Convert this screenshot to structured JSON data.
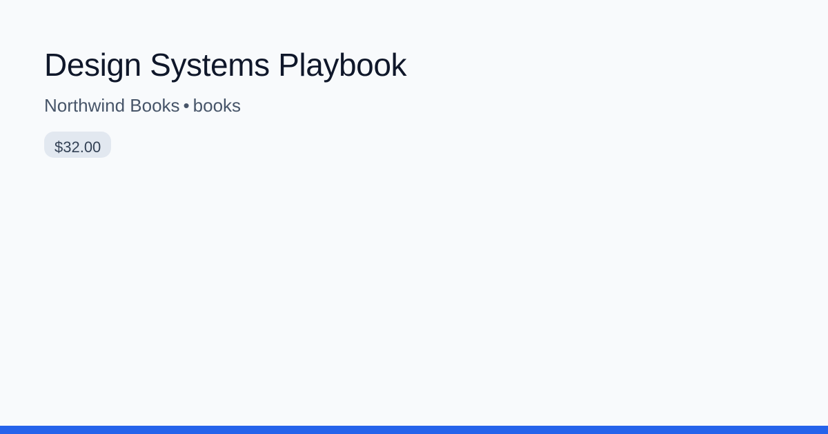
{
  "product": {
    "title": "Design Systems Playbook",
    "vendor": "Northwind Books",
    "separator": "•",
    "category": "books",
    "price": "$32.00"
  },
  "colors": {
    "background": "#f8fafc",
    "title": "#0f172a",
    "subtitle": "#475569",
    "badge_background": "#e2e8f0",
    "accent": "#2563eb"
  }
}
